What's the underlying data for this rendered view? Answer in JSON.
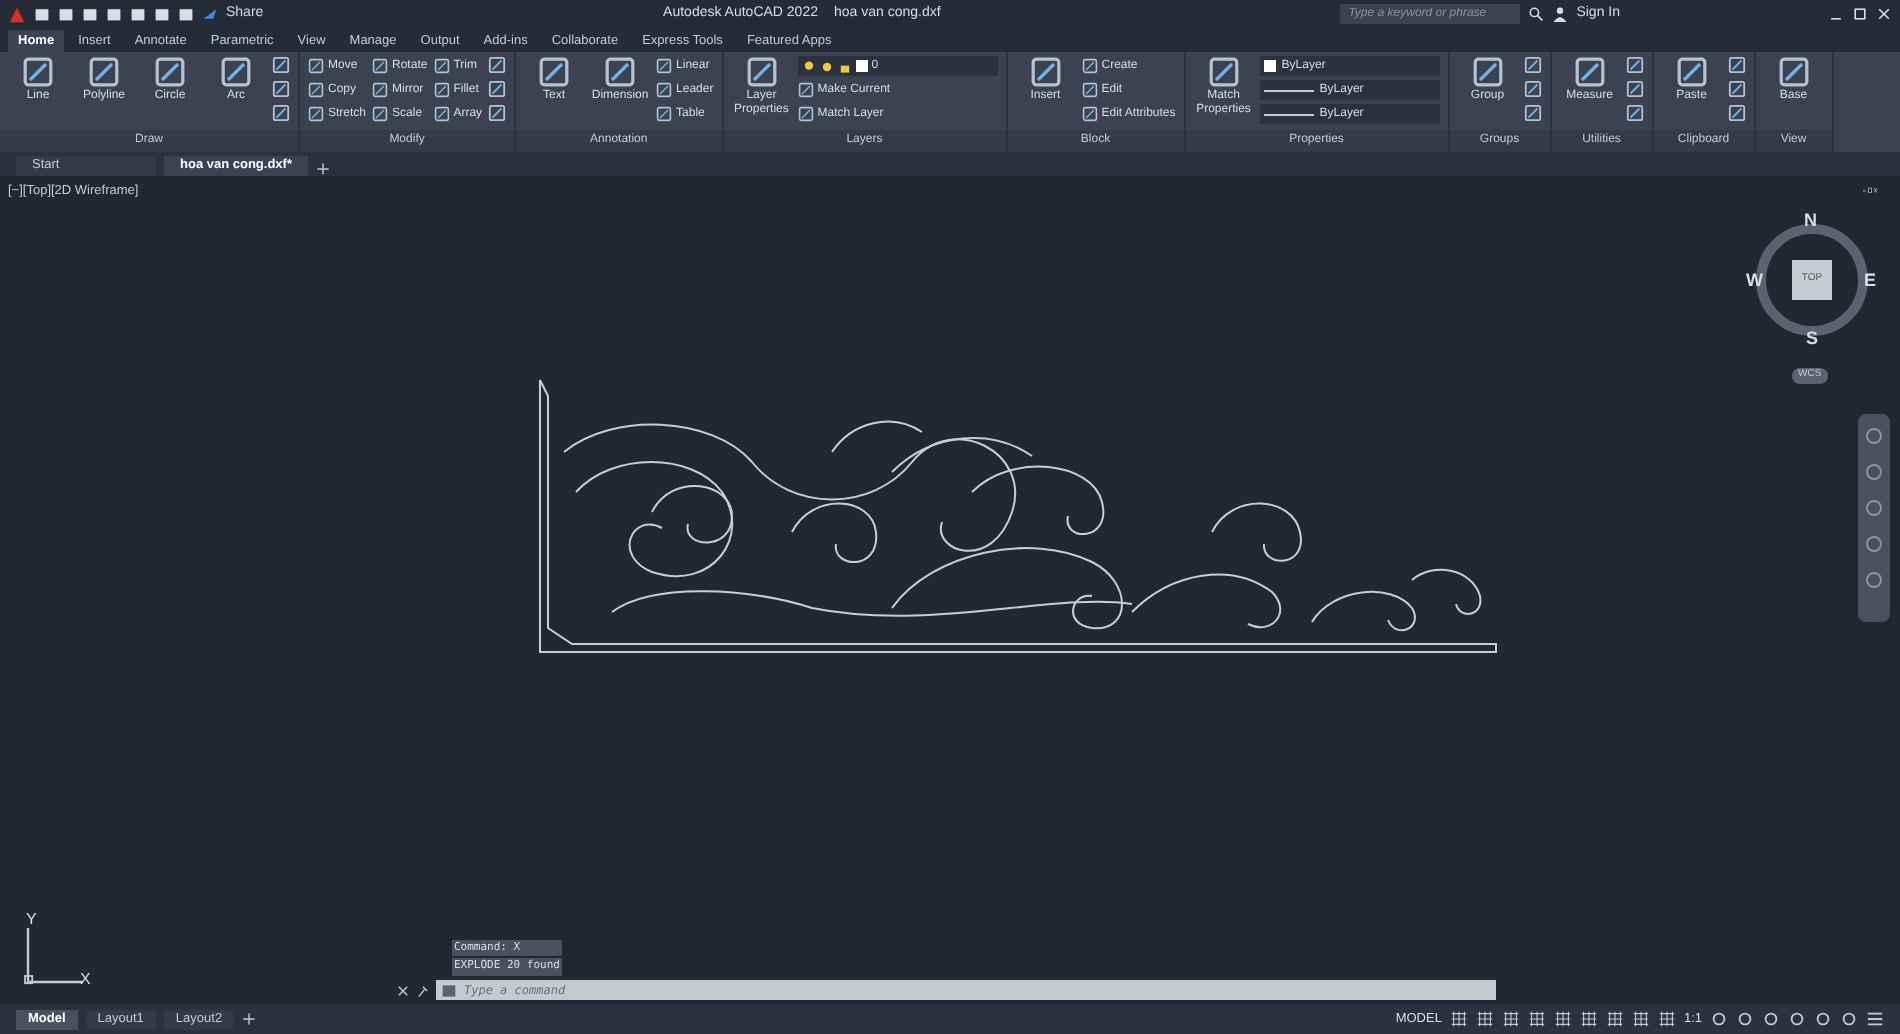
{
  "title_bar": {
    "share": "Share",
    "app_title": "Autodesk AutoCAD 2022",
    "file_name": "hoa van cong.dxf",
    "search": {
      "placeholder": "Type a keyword or phrase"
    },
    "sign_in": "Sign In"
  },
  "ribbon_tabs": [
    {
      "label": "Home",
      "selected": true
    },
    {
      "label": "Insert",
      "selected": false
    },
    {
      "label": "Annotate",
      "selected": false
    },
    {
      "label": "Parametric",
      "selected": false
    },
    {
      "label": "View",
      "selected": false
    },
    {
      "label": "Manage",
      "selected": false
    },
    {
      "label": "Output",
      "selected": false
    },
    {
      "label": "Add-ins",
      "selected": false
    },
    {
      "label": "Collaborate",
      "selected": false
    },
    {
      "label": "Express Tools",
      "selected": false
    },
    {
      "label": "Featured Apps",
      "selected": false
    }
  ],
  "ribbon_panels": [
    {
      "title": "Draw",
      "columns": [
        {
          "kind": "large",
          "label": "Line"
        },
        {
          "kind": "large",
          "label": "Polyline"
        },
        {
          "kind": "large",
          "label": "Circle"
        },
        {
          "kind": "large",
          "label": "Arc"
        },
        {
          "kind": "icons"
        }
      ]
    },
    {
      "title": "Modify",
      "columns": [
        {
          "kind": "stack",
          "items": [
            "Move",
            "Copy",
            "Stretch"
          ]
        },
        {
          "kind": "stack",
          "items": [
            "Rotate",
            "Mirror",
            "Scale"
          ]
        },
        {
          "kind": "stack",
          "items": [
            "Trim",
            "Fillet",
            "Array"
          ]
        },
        {
          "kind": "icons"
        }
      ]
    },
    {
      "title": "Annotation",
      "columns": [
        {
          "kind": "large",
          "label": "Text"
        },
        {
          "kind": "large",
          "label": "Dimension"
        },
        {
          "kind": "stack",
          "items": [
            "Linear",
            "Leader",
            "Table"
          ]
        }
      ]
    },
    {
      "title": "Layers",
      "columns": [
        {
          "kind": "large",
          "label": "Layer Properties"
        },
        {
          "kind": "layer",
          "value": "0",
          "items": [
            "Make Current",
            "Match Layer"
          ]
        }
      ]
    },
    {
      "title": "Block",
      "columns": [
        {
          "kind": "large",
          "label": "Insert"
        },
        {
          "kind": "stack",
          "items": [
            "Create",
            "Edit",
            "Edit Attributes"
          ]
        }
      ]
    },
    {
      "title": "Properties",
      "columns": [
        {
          "kind": "large",
          "label": "Match Properties"
        },
        {
          "kind": "dropdowns",
          "items": [
            "ByLayer",
            "ByLayer",
            "ByLayer"
          ]
        }
      ]
    },
    {
      "title": "Groups",
      "columns": [
        {
          "kind": "large",
          "label": "Group"
        },
        {
          "kind": "icons"
        }
      ]
    },
    {
      "title": "Utilities",
      "columns": [
        {
          "kind": "large",
          "label": "Measure"
        },
        {
          "kind": "icons"
        }
      ]
    },
    {
      "title": "Clipboard",
      "columns": [
        {
          "kind": "large",
          "label": "Paste"
        },
        {
          "kind": "icons"
        }
      ]
    },
    {
      "title": "View",
      "columns": [
        {
          "kind": "large",
          "label": "Base"
        }
      ]
    }
  ],
  "doc_tabs": [
    {
      "label": "Start",
      "selected": false
    },
    {
      "label": "hoa van cong.dxf*",
      "selected": true
    }
  ],
  "viewport": {
    "label": "[−][Top][2D Wireframe]",
    "viewcube": {
      "top": "TOP",
      "north": "N",
      "south": "S",
      "east": "E",
      "west": "W",
      "ucs": "WCS"
    },
    "axes": {
      "x": "X",
      "y": "Y"
    }
  },
  "command_line": {
    "history": [
      "Command: X",
      "EXPLODE 20 found"
    ],
    "placeholder": "Type a command"
  },
  "layout_tabs": [
    {
      "label": "Model",
      "selected": true
    },
    {
      "label": "Layout1",
      "selected": false
    },
    {
      "label": "Layout2",
      "selected": false
    }
  ],
  "status_bar": {
    "model": "MODEL",
    "scale": "1:1"
  }
}
